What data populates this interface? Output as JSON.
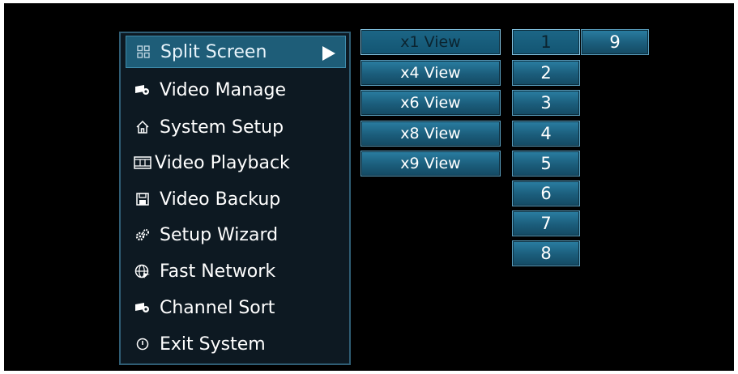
{
  "menu": {
    "items": [
      {
        "label": "Split Screen",
        "icon": "grid-icon"
      },
      {
        "label": "Video Manage",
        "icon": "camera-icon"
      },
      {
        "label": "System Setup",
        "icon": "home-icon"
      },
      {
        "label": "Video Playback",
        "icon": "film-icon"
      },
      {
        "label": "Video Backup",
        "icon": "floppy-icon"
      },
      {
        "label": "Setup Wizard",
        "icon": "gears-icon"
      },
      {
        "label": "Fast Network",
        "icon": "globe-icon"
      },
      {
        "label": "Channel Sort",
        "icon": "camera-icon"
      },
      {
        "label": "Exit System",
        "icon": "power-icon"
      }
    ],
    "selected": "Split Screen"
  },
  "views": {
    "items": [
      "x1 View",
      "x4 View",
      "x6 View",
      "x8 View",
      "x9 View"
    ],
    "selected": "x1 View"
  },
  "channels": {
    "items": [
      "1",
      "2",
      "3",
      "4",
      "5",
      "6",
      "7",
      "8",
      "9"
    ],
    "selected": "1"
  },
  "colors": {
    "background": "#000000",
    "menu_bg": "#0d1922",
    "menu_border": "#2f5d74",
    "accent": "#1e5d78",
    "button": "#1b5d7b"
  }
}
